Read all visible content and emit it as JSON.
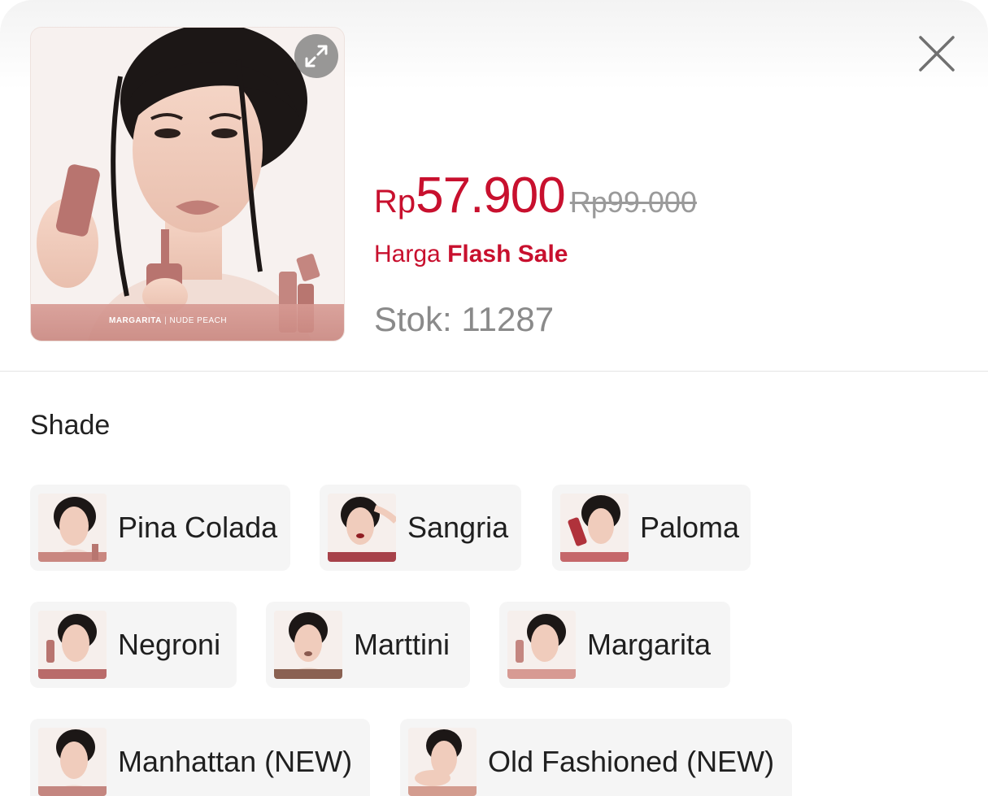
{
  "header": {
    "image_caption_brand": "MARGARITA",
    "image_caption_shade": "NUDE PEACH",
    "expand_icon": "expand-icon",
    "close_icon": "close-icon"
  },
  "price": {
    "currency": "Rp",
    "amount": "57.900",
    "original": "Rp99.000"
  },
  "flash": {
    "prefix": "Harga",
    "label": "Flash Sale"
  },
  "stock": {
    "text": "Stok: 11287"
  },
  "variants": {
    "title": "Shade",
    "options": [
      {
        "label": "Pina Colada"
      },
      {
        "label": "Sangria"
      },
      {
        "label": "Paloma"
      },
      {
        "label": "Negroni"
      },
      {
        "label": "Marttini"
      },
      {
        "label": "Margarita"
      },
      {
        "label": "Manhattan (NEW)"
      },
      {
        "label": "Old Fashioned (NEW)"
      }
    ]
  },
  "colors": {
    "accent": "#c8102e",
    "muted": "#9a9a9a",
    "chip_bg": "#f5f5f5"
  }
}
